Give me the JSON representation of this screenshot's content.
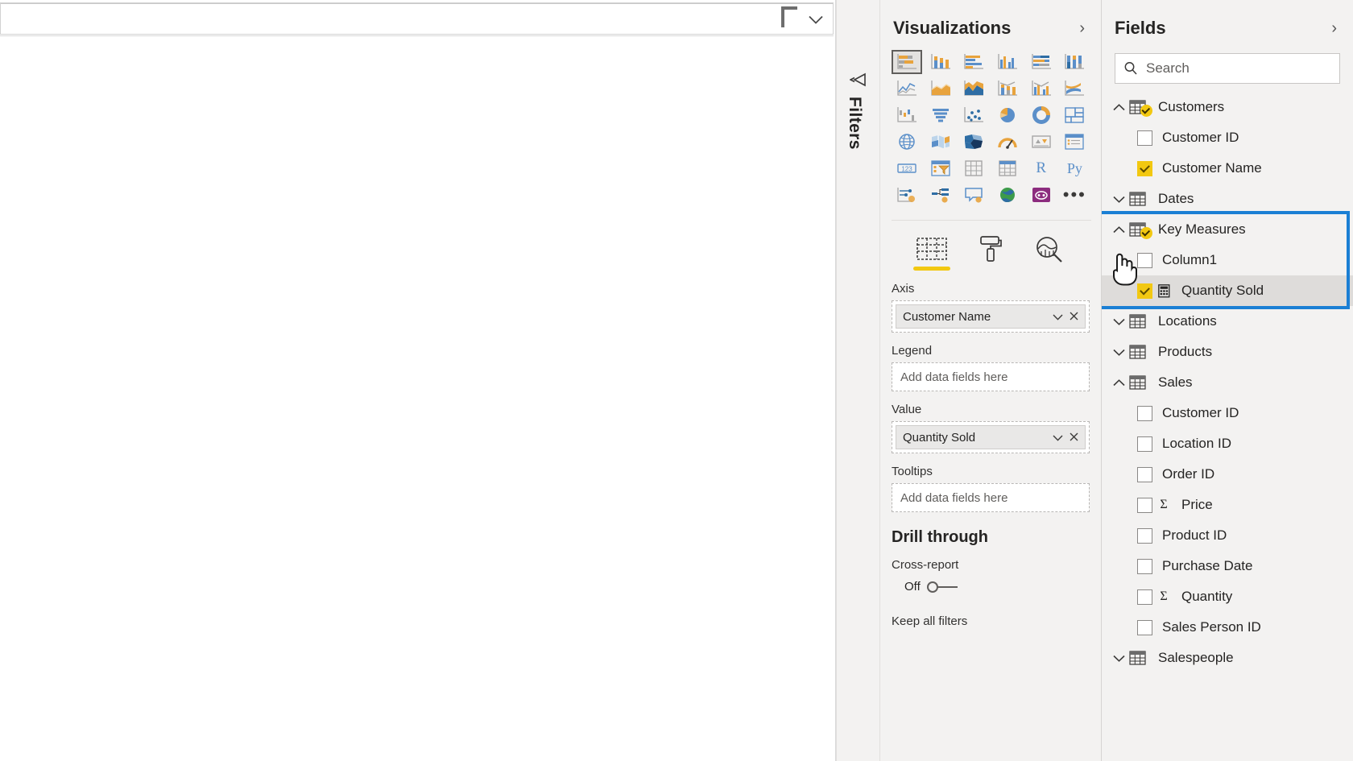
{
  "canvas": {
    "slicer_dropdown_icon": "chevron-down-icon",
    "slicer_handle_icon": "slicer-corner-handle-icon"
  },
  "filters_rail": {
    "label": "Filters",
    "expand_icon": "filter-funnel-icon"
  },
  "visualizations": {
    "title": "Visualizations",
    "collapse_icon": "chevron-right-icon",
    "gallery": [
      {
        "name": "stacked-bar-chart-icon",
        "selected": true
      },
      {
        "name": "stacked-column-chart-icon",
        "selected": false
      },
      {
        "name": "clustered-bar-chart-icon",
        "selected": false
      },
      {
        "name": "clustered-column-chart-icon",
        "selected": false
      },
      {
        "name": "hundred-percent-stacked-bar-chart-icon",
        "selected": false
      },
      {
        "name": "hundred-percent-stacked-column-chart-icon",
        "selected": false
      },
      {
        "name": "line-chart-icon",
        "selected": false
      },
      {
        "name": "area-chart-icon",
        "selected": false
      },
      {
        "name": "stacked-area-chart-icon",
        "selected": false
      },
      {
        "name": "line-and-stacked-column-chart-icon",
        "selected": false
      },
      {
        "name": "line-and-clustered-column-chart-icon",
        "selected": false
      },
      {
        "name": "ribbon-chart-icon",
        "selected": false
      },
      {
        "name": "waterfall-chart-icon",
        "selected": false
      },
      {
        "name": "funnel-chart-icon",
        "selected": false
      },
      {
        "name": "scatter-chart-icon",
        "selected": false
      },
      {
        "name": "pie-chart-icon",
        "selected": false
      },
      {
        "name": "donut-chart-icon",
        "selected": false
      },
      {
        "name": "treemap-icon",
        "selected": false
      },
      {
        "name": "map-icon",
        "selected": false
      },
      {
        "name": "filled-map-icon",
        "selected": false
      },
      {
        "name": "shape-map-icon",
        "selected": false
      },
      {
        "name": "gauge-icon",
        "selected": false
      },
      {
        "name": "card-icon",
        "selected": false
      },
      {
        "name": "multi-row-card-icon",
        "selected": false
      },
      {
        "name": "kpi-icon",
        "selected": false
      },
      {
        "name": "slicer-icon",
        "selected": false
      },
      {
        "name": "table-icon",
        "selected": false
      },
      {
        "name": "matrix-icon",
        "selected": false
      },
      {
        "name": "r-script-visual-icon",
        "label": "R",
        "selected": false
      },
      {
        "name": "python-visual-icon",
        "label": "Py",
        "selected": false
      },
      {
        "name": "key-influencers-icon",
        "selected": false
      },
      {
        "name": "decomposition-tree-icon",
        "selected": false
      },
      {
        "name": "qna-icon",
        "selected": false
      },
      {
        "name": "arcgis-map-icon",
        "selected": false
      },
      {
        "name": "power-apps-visual-icon",
        "selected": false
      },
      {
        "name": "more-visuals-icon",
        "label": "•••",
        "selected": false
      }
    ],
    "tabs": [
      {
        "name": "fields-tab",
        "icon": "fields-grid-icon",
        "active": true
      },
      {
        "name": "format-tab",
        "icon": "paint-roller-icon",
        "active": false
      },
      {
        "name": "analytics-tab",
        "icon": "analytics-magnifier-icon",
        "active": false
      }
    ],
    "wells": [
      {
        "label": "Axis",
        "field": "Customer Name",
        "placeholder": "Add data fields here",
        "has_field": true,
        "dropdown_icon": "chevron-down-icon",
        "remove_icon": "close-icon"
      },
      {
        "label": "Legend",
        "field": "",
        "placeholder": "Add data fields here",
        "has_field": false
      },
      {
        "label": "Value",
        "field": "Quantity Sold",
        "placeholder": "Add data fields here",
        "has_field": true,
        "dropdown_icon": "chevron-down-icon",
        "remove_icon": "close-icon"
      },
      {
        "label": "Tooltips",
        "field": "",
        "placeholder": "Add data fields here",
        "has_field": false
      }
    ],
    "drill_through": {
      "title": "Drill through",
      "cross_report_label": "Cross-report",
      "toggle_state": "Off",
      "keep_all_filters_label": "Keep all filters"
    }
  },
  "fields": {
    "title": "Fields",
    "collapse_icon": "chevron-right-icon",
    "search": {
      "placeholder": "Search",
      "value": "",
      "icon": "search-icon"
    },
    "tree": [
      {
        "type": "table",
        "name": "Customers",
        "expanded": true,
        "has_yellow_badge": true,
        "children": [
          {
            "name": "Customer ID",
            "checked": false,
            "kind": "column"
          },
          {
            "name": "Customer Name",
            "checked": true,
            "kind": "column"
          }
        ]
      },
      {
        "type": "table",
        "name": "Dates",
        "expanded": false,
        "has_yellow_badge": false,
        "children": []
      },
      {
        "type": "table",
        "name": "Key Measures",
        "expanded": true,
        "has_yellow_badge": true,
        "highlighted": true,
        "children": [
          {
            "name": "Column1",
            "checked": false,
            "kind": "column"
          },
          {
            "name": "Quantity Sold",
            "checked": true,
            "kind": "measure",
            "selected": true
          }
        ]
      },
      {
        "type": "table",
        "name": "Locations",
        "expanded": false,
        "has_yellow_badge": false,
        "children": []
      },
      {
        "type": "table",
        "name": "Products",
        "expanded": false,
        "has_yellow_badge": false,
        "children": []
      },
      {
        "type": "table",
        "name": "Sales",
        "expanded": true,
        "has_yellow_badge": false,
        "children": [
          {
            "name": "Customer ID",
            "checked": false,
            "kind": "column"
          },
          {
            "name": "Location ID",
            "checked": false,
            "kind": "column"
          },
          {
            "name": "Order ID",
            "checked": false,
            "kind": "column"
          },
          {
            "name": "Price",
            "checked": false,
            "kind": "summable"
          },
          {
            "name": "Product ID",
            "checked": false,
            "kind": "column"
          },
          {
            "name": "Purchase Date",
            "checked": false,
            "kind": "column"
          },
          {
            "name": "Quantity",
            "checked": false,
            "kind": "summable"
          },
          {
            "name": "Sales Person ID",
            "checked": false,
            "kind": "column"
          }
        ]
      },
      {
        "type": "table",
        "name": "Salespeople",
        "expanded": false,
        "has_yellow_badge": false,
        "children": []
      }
    ]
  },
  "annotations": {
    "highlight_color": "#1b7fd4",
    "cursor_icon": "pointing-hand-cursor"
  }
}
